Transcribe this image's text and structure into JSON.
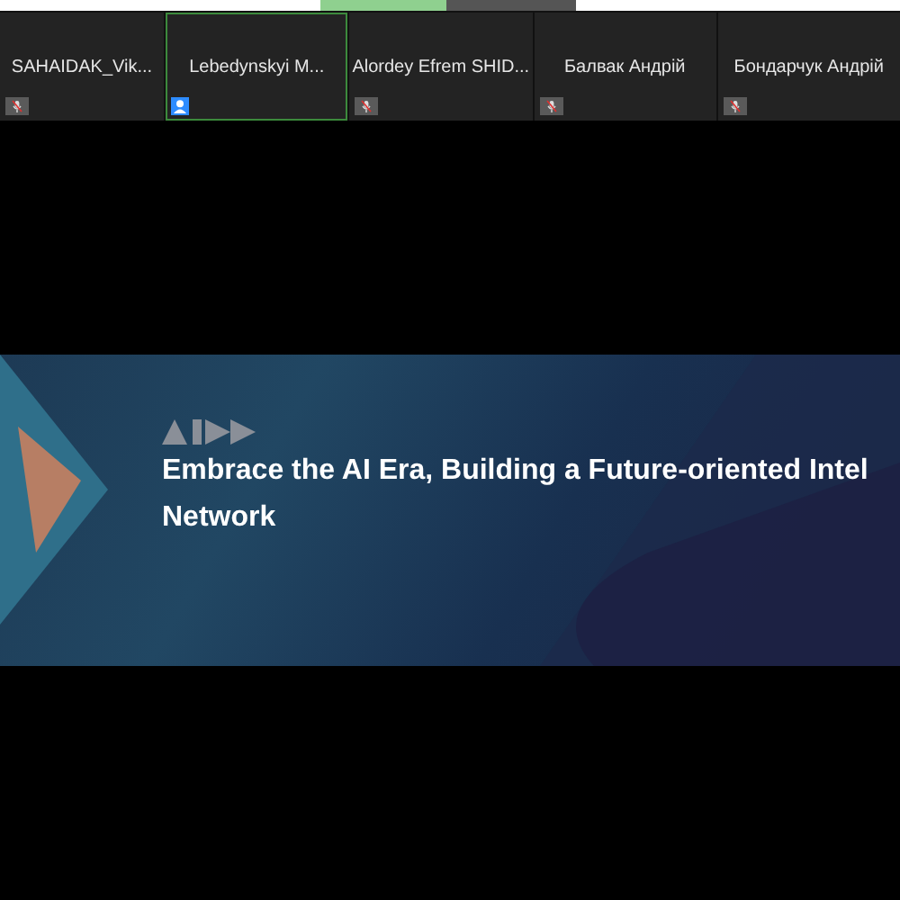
{
  "participants": [
    {
      "name": "SAHAIDAK_Vik...",
      "selected": false,
      "kind": "muted"
    },
    {
      "name": "Lebedynskyi M...",
      "selected": true,
      "kind": "person"
    },
    {
      "name": "Alordey Efrem SHID...",
      "selected": false,
      "kind": "muted"
    },
    {
      "name": "Балвак Андрій",
      "selected": false,
      "kind": "muted"
    },
    {
      "name": "Бондарчук Андрій",
      "selected": false,
      "kind": "muted"
    }
  ],
  "slide": {
    "title": "Embrace the AI Era, Building a Future-oriented Intel",
    "title_line_2": "Network"
  }
}
